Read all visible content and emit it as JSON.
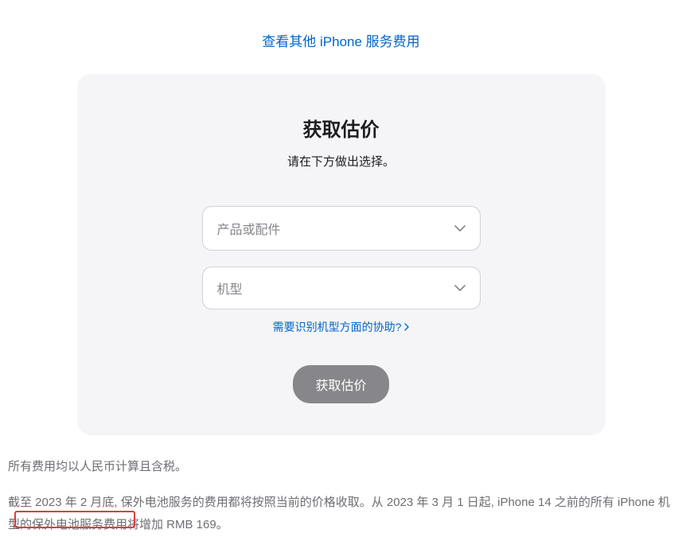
{
  "topLink": {
    "text": "查看其他 iPhone 服务费用"
  },
  "card": {
    "title": "获取估价",
    "subtitle": "请在下方做出选择。",
    "select1": {
      "placeholder": "产品或配件"
    },
    "select2": {
      "placeholder": "机型"
    },
    "helpLink": {
      "text": "需要识别机型方面的协助?"
    },
    "submitButton": {
      "label": "获取估价"
    }
  },
  "footer": {
    "para1": "所有费用均以人民币计算且含税。",
    "para2": "截至 2023 年 2 月底, 保外电池服务的费用都将按照当前的价格收取。从 2023 年 3 月 1 日起, iPhone 14 之前的所有 iPhone 机型的保外电池服务费用将增加 RMB 169。"
  }
}
